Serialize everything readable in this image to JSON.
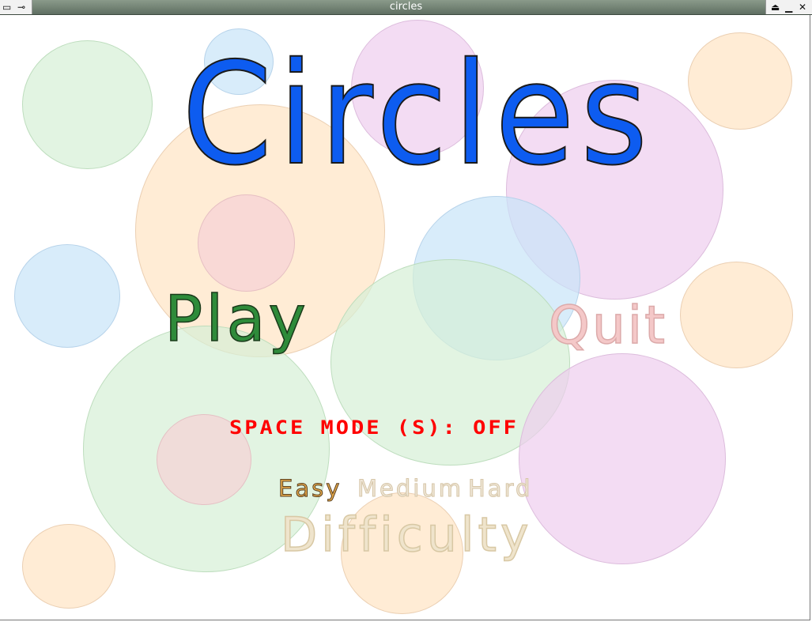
{
  "window": {
    "title": "circles"
  },
  "menu": {
    "game_title": "Circles",
    "play_label": "Play",
    "quit_label": "Quit",
    "space_mode_label": "SPACE MODE (S): OFF",
    "difficulty": {
      "options": [
        "Easy",
        "Medium",
        "Hard"
      ],
      "selected": "Easy",
      "label": "Difficulty"
    }
  },
  "colors": {
    "title": "#0d5cf0",
    "play": "#2e8b3a",
    "quit": "#f4c8c8",
    "space_mode": "#ff0000",
    "difficulty_selected": "#e4a84a",
    "difficulty_unselected": "#efe6d6",
    "bubble_green": "#d6f0d6",
    "bubble_orange": "#ffe4c3",
    "bubble_purple": "#eecdee",
    "bubble_blue": "#c8e4f8",
    "bubble_pink": "#f6d2d6"
  },
  "icons": [
    "window-menu-icon",
    "pin-icon",
    "shade-icon",
    "minimize-icon",
    "close-icon"
  ]
}
